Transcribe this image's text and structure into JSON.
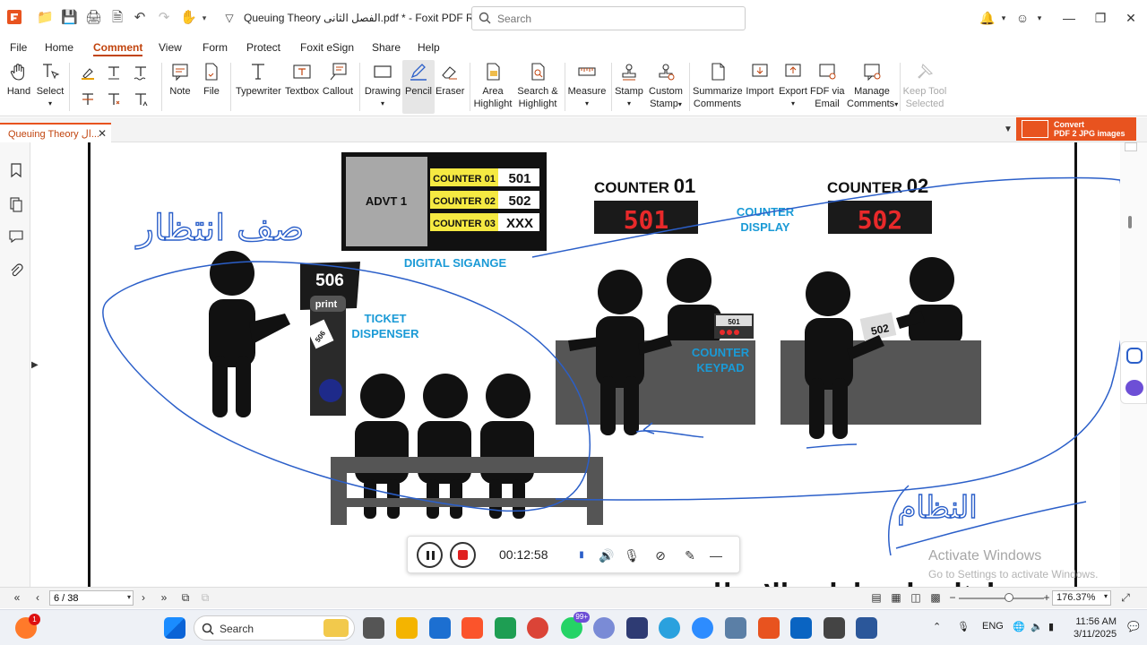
{
  "titlebar": {
    "title": "Queuing Theory الفصل الثانى.pdf * - Foxit PDF Reader",
    "search_placeholder": "Search"
  },
  "menu": [
    "File",
    "Home",
    "Comment",
    "View",
    "Form",
    "Protect",
    "Foxit eSign",
    "Share",
    "Help"
  ],
  "menu_active": "Comment",
  "ribbon": {
    "hand": "Hand",
    "select": "Select",
    "note": "Note",
    "file": "File",
    "typewriter": "Typewriter",
    "textbox": "Textbox",
    "callout": "Callout",
    "drawing": "Drawing",
    "pencil": "Pencil",
    "eraser": "Eraser",
    "area_highlight_1": "Area",
    "area_highlight_2": "Highlight",
    "search_highlight_1": "Search &",
    "search_highlight_2": "Highlight",
    "measure": "Measure",
    "stamp": "Stamp",
    "custom_stamp_1": "Custom",
    "custom_stamp_2": "Stamp",
    "summarize_1": "Summarize",
    "summarize_2": "Comments",
    "import": "Import",
    "export": "Export",
    "fdf_1": "FDF via",
    "fdf_2": "Email",
    "manage_1": "Manage",
    "manage_2": "Comments",
    "keep_1": "Keep Tool",
    "keep_2": "Selected"
  },
  "tab": {
    "label": "Queuing Theory ال...",
    "ad_line1": "Convert",
    "ad_line2": "PDF 2 JPG images"
  },
  "slide": {
    "advt": "ADVT 1",
    "board": [
      {
        "counter": "COUNTER 01",
        "value": "501"
      },
      {
        "counter": "COUNTER 02",
        "value": "502"
      },
      {
        "counter": "COUNTER 03",
        "value": "XXX"
      }
    ],
    "digital_signage": "DIGITAL SIGANGE",
    "counter01_label": "COUNTER",
    "counter01_num": "01",
    "counter02_label": "COUNTER",
    "counter02_num": "02",
    "display1": "501",
    "display2": "502",
    "counter_display_1": "COUNTER",
    "counter_display_2": "DISPLAY",
    "ticket_number": "506",
    "ticket_print": "print",
    "ticket_slip": "506",
    "ticket_dispenser_1": "TICKET",
    "ticket_dispenser_2": "DISPENSER",
    "keypad_num": "501",
    "counter_keypad_1": "COUNTER",
    "counter_keypad_2": "KEYPAD",
    "ticket_hand": "502",
    "handwriting_1": "صف انتظار",
    "handwriting_2": "النظام",
    "bottom_text": "امثلة على طوابير الانتظار"
  },
  "recorder": {
    "time": "00:12:58"
  },
  "watermark": {
    "line1": "Activate Windows",
    "line2": "Go to Settings to activate Windows."
  },
  "status": {
    "page": "6 / 38",
    "zoom": "176.37%"
  },
  "taskbar": {
    "search": "Search",
    "whatsapp_badge": "99+",
    "notif_badge": "1",
    "lang": "ENG",
    "time": "11:56 AM",
    "date": "3/11/2025"
  },
  "colors": {
    "accent": "#e8531f",
    "annotation_blue": "#2b5fc9",
    "slide_blue": "#1a9ad6",
    "display_red": "#e8292a"
  }
}
